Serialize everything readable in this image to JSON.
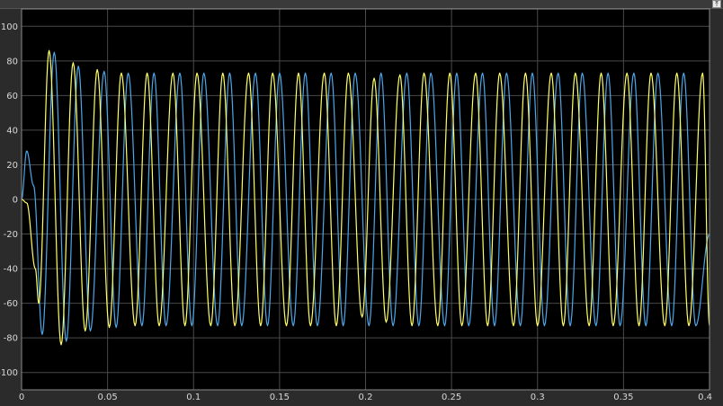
{
  "toolbar": {
    "undock_glyph": "⤒"
  },
  "chart_data": {
    "type": "line",
    "title": "",
    "xlabel": "",
    "ylabel": "",
    "xlim": [
      0,
      0.4
    ],
    "ylim": [
      -110,
      110
    ],
    "xticks": [
      0,
      0.05,
      0.1,
      0.15,
      0.2,
      0.25,
      0.3,
      0.35,
      0.4
    ],
    "xtick_labels": [
      "0",
      "0.05",
      "0.1",
      "0.15",
      "0.2",
      "0.25",
      "0.3",
      "0.35",
      "0.4"
    ],
    "yticks": [
      100,
      80,
      60,
      40,
      20,
      0,
      -20,
      -40,
      -60,
      -80,
      -100
    ],
    "ytick_labels": [
      "100",
      "80",
      "60",
      "40",
      "20",
      "0",
      "-20",
      "-40",
      "-60",
      "-80",
      "-100"
    ],
    "grid": true,
    "legend": "none",
    "background": "#000000",
    "series": [
      {
        "color": "#4da6e8",
        "x": [
          0,
          0.003,
          0.007,
          0.012,
          0.019,
          0.026,
          0.033,
          0.04,
          0.048,
          0.055,
          0.062,
          0.07,
          0.077,
          0.084,
          0.092,
          0.099,
          0.106,
          0.114,
          0.121,
          0.128,
          0.136,
          0.143,
          0.15,
          0.158,
          0.165,
          0.172,
          0.18,
          0.187,
          0.194,
          0.202,
          0.209,
          0.216,
          0.224,
          0.231,
          0.238,
          0.246,
          0.253,
          0.26,
          0.268,
          0.275,
          0.282,
          0.29,
          0.297,
          0.304,
          0.312,
          0.319,
          0.326,
          0.334,
          0.341,
          0.348,
          0.356,
          0.363,
          0.37,
          0.378,
          0.385,
          0.392,
          0.4
        ],
        "y": [
          0,
          28,
          8,
          -78,
          85,
          -82,
          77,
          -76,
          74,
          -74,
          73,
          -73,
          73,
          -73,
          73,
          -73,
          73,
          -73,
          73,
          -73,
          73,
          -73,
          73,
          -73,
          73,
          -73,
          73,
          -73,
          73,
          -73,
          73,
          -73,
          73,
          -73,
          73,
          -73,
          73,
          -73,
          73,
          -73,
          73,
          -73,
          73,
          -73,
          73,
          -73,
          73,
          -73,
          73,
          -73,
          73,
          -73,
          73,
          -73,
          73,
          -73,
          -20
        ]
      },
      {
        "color": "#ffff66",
        "x": [
          0,
          0.003,
          0.008,
          0.01,
          0.016,
          0.023,
          0.03,
          0.037,
          0.044,
          0.051,
          0.058,
          0.066,
          0.073,
          0.08,
          0.088,
          0.095,
          0.102,
          0.11,
          0.117,
          0.124,
          0.132,
          0.139,
          0.146,
          0.154,
          0.161,
          0.168,
          0.176,
          0.183,
          0.19,
          0.198,
          0.205,
          0.212,
          0.22,
          0.227,
          0.234,
          0.242,
          0.249,
          0.256,
          0.264,
          0.271,
          0.278,
          0.286,
          0.293,
          0.3,
          0.308,
          0.315,
          0.322,
          0.33,
          0.337,
          0.344,
          0.352,
          0.359,
          0.366,
          0.374,
          0.381,
          0.388,
          0.396,
          0.4
        ],
        "y": [
          0,
          -2,
          -40,
          -60,
          86,
          -84,
          79,
          -76,
          75,
          -74,
          73,
          -73,
          73,
          -73,
          73,
          -73,
          73,
          -73,
          73,
          -73,
          73,
          -73,
          73,
          -73,
          73,
          -73,
          73,
          -73,
          73,
          -68,
          70,
          -71,
          72,
          -73,
          73,
          -73,
          73,
          -73,
          73,
          -73,
          73,
          -73,
          73,
          -73,
          73,
          -73,
          73,
          -73,
          73,
          -73,
          73,
          -73,
          73,
          -73,
          73,
          -73,
          73,
          -73
        ]
      }
    ]
  }
}
